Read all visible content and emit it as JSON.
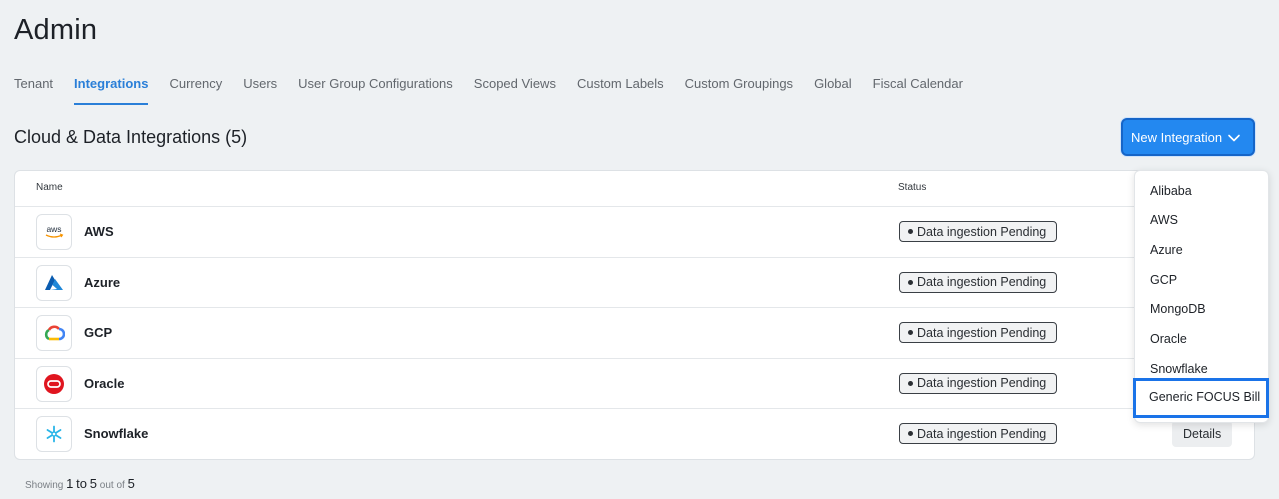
{
  "page": {
    "title": "Admin"
  },
  "tabs": [
    {
      "label": "Tenant"
    },
    {
      "label": "Integrations"
    },
    {
      "label": "Currency"
    },
    {
      "label": "Users"
    },
    {
      "label": "User Group Configurations"
    },
    {
      "label": "Scoped Views"
    },
    {
      "label": "Custom Labels"
    },
    {
      "label": "Custom Groupings"
    },
    {
      "label": "Global"
    },
    {
      "label": "Fiscal Calendar"
    }
  ],
  "active_tab": "Integrations",
  "section": {
    "title": "Cloud & Data Integrations (5)"
  },
  "new_button": {
    "label": "New Integration"
  },
  "table": {
    "columns": [
      "Name",
      "Status"
    ],
    "rows": [
      {
        "name": "AWS",
        "status": "Data ingestion Pending",
        "logo": "aws-logo-icon"
      },
      {
        "name": "Azure",
        "status": "Data ingestion Pending",
        "logo": "azure-logo-icon"
      },
      {
        "name": "GCP",
        "status": "Data ingestion Pending",
        "logo": "gcp-logo-icon"
      },
      {
        "name": "Oracle",
        "status": "Data ingestion Pending",
        "logo": "oracle-logo-icon"
      },
      {
        "name": "Snowflake",
        "status": "Data ingestion Pending",
        "logo": "snowflake-logo-icon",
        "action": "Details"
      }
    ]
  },
  "footer": {
    "prefix": "Showing",
    "from": "1",
    "to_word": "to",
    "to": "5",
    "out_of": "out of",
    "total": "5"
  },
  "dropdown": {
    "items": [
      "Alibaba",
      "AWS",
      "Azure",
      "GCP",
      "MongoDB",
      "Oracle",
      "Snowflake"
    ],
    "highlighted": "Generic FOCUS Bill"
  },
  "colors": {
    "accent": "#2388f0",
    "active_tab": "#2a7fd8",
    "highlight_border": "#1a73e8"
  }
}
